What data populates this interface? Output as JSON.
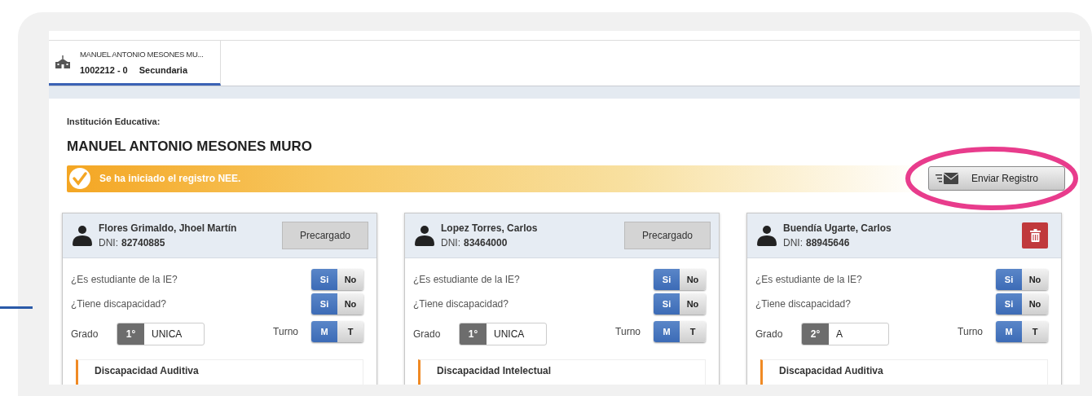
{
  "school_tab": {
    "name": "MANUEL ANTONIO MESONES MU...",
    "code": "1002212 - 0",
    "level": "Secundaria",
    "selected": true
  },
  "institution": {
    "label": "Institución Educativa:",
    "name": "MANUEL ANTONIO MESONES MURO"
  },
  "banner": {
    "message": "Se ha iniciado el registro NEE."
  },
  "send_button": {
    "label": "Enviar Registro",
    "highlighted": true
  },
  "students": [
    {
      "name": "Flores Grimaldo, Jhoel Martín",
      "dni_label": "DNI:",
      "dni": "82740885",
      "action": {
        "kind": "status",
        "label": "Precargado"
      },
      "questions": [
        {
          "label": "¿Es estudiante de la IE?",
          "options": [
            {
              "label": "Si",
              "selected": true
            },
            {
              "label": "No",
              "selected": false
            }
          ]
        },
        {
          "label": "¿Tiene discapacidad?",
          "options": [
            {
              "label": "Si",
              "selected": true
            },
            {
              "label": "No",
              "selected": false
            }
          ]
        }
      ],
      "grade_label": "Grado",
      "grade": "1°",
      "section": "UNICA",
      "shift_label": "Turno",
      "shifts": [
        {
          "label": "M",
          "selected": true
        },
        {
          "label": "T",
          "selected": false
        }
      ],
      "disability": "Discapacidad Auditiva"
    },
    {
      "name": "Lopez Torres, Carlos",
      "dni_label": "DNI:",
      "dni": "83464000",
      "action": {
        "kind": "status",
        "label": "Precargado"
      },
      "questions": [
        {
          "label": "¿Es estudiante de la IE?",
          "options": [
            {
              "label": "Si",
              "selected": true
            },
            {
              "label": "No",
              "selected": false
            }
          ]
        },
        {
          "label": "¿Tiene discapacidad?",
          "options": [
            {
              "label": "Si",
              "selected": true
            },
            {
              "label": "No",
              "selected": false
            }
          ]
        }
      ],
      "grade_label": "Grado",
      "grade": "1°",
      "section": "UNICA",
      "shift_label": "Turno",
      "shifts": [
        {
          "label": "M",
          "selected": true
        },
        {
          "label": "T",
          "selected": false
        }
      ],
      "disability": "Discapacidad Intelectual"
    },
    {
      "name": "Buendía Ugarte, Carlos",
      "dni_label": "DNI:",
      "dni": "88945646",
      "action": {
        "kind": "delete"
      },
      "questions": [
        {
          "label": "¿Es estudiante de la IE?",
          "options": [
            {
              "label": "Si",
              "selected": true
            },
            {
              "label": "No",
              "selected": false
            }
          ]
        },
        {
          "label": "¿Tiene discapacidad?",
          "options": [
            {
              "label": "Si",
              "selected": true
            },
            {
              "label": "No",
              "selected": false
            }
          ]
        }
      ],
      "grade_label": "Grado",
      "grade": "2°",
      "section": "A",
      "shift_label": "Turno",
      "shifts": [
        {
          "label": "M",
          "selected": true
        },
        {
          "label": "T",
          "selected": false
        }
      ],
      "disability": "Discapacidad Auditiva"
    }
  ]
}
